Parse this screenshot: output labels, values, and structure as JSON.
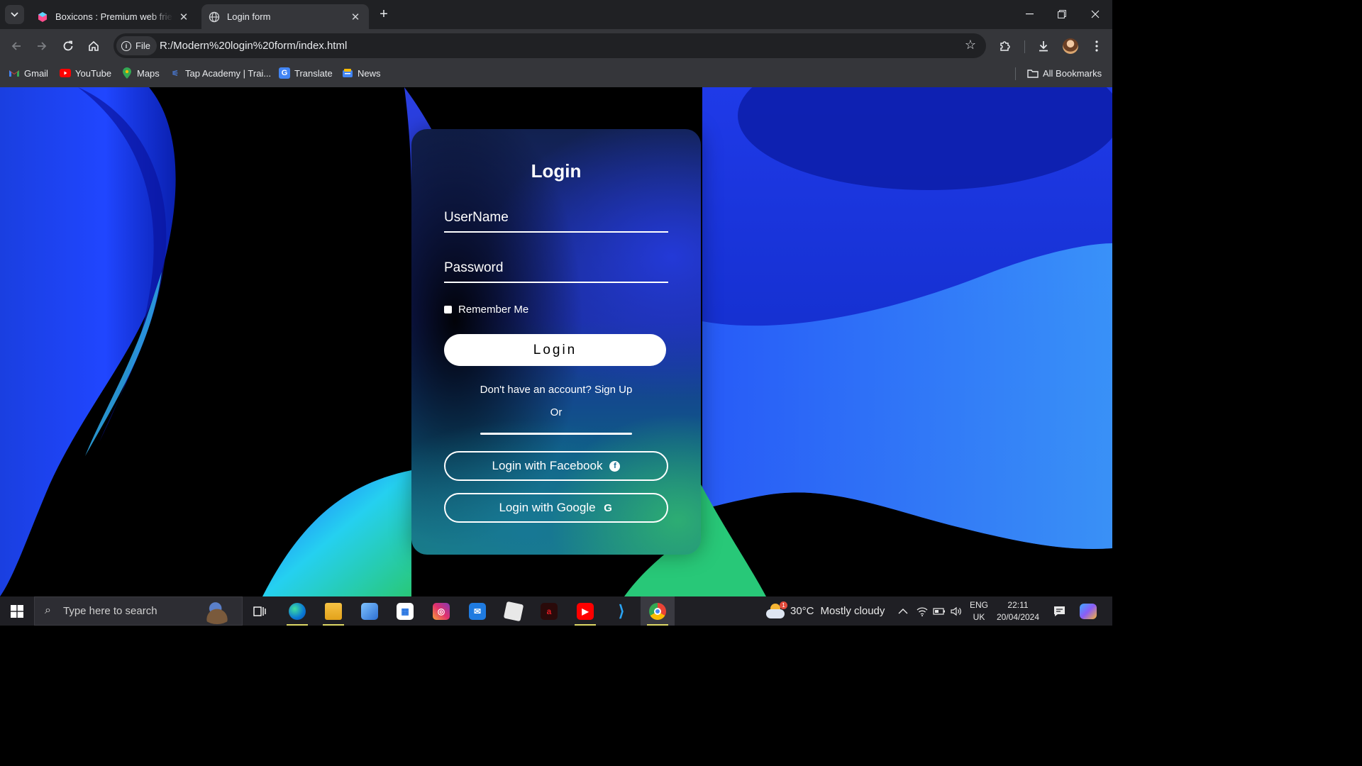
{
  "browser": {
    "tabs": [
      {
        "title": "Boxicons : Premium web friendly icons",
        "active": false,
        "favicon": "boxicons-icon"
      },
      {
        "title": "Login form",
        "active": true,
        "favicon": "globe-icon"
      }
    ],
    "close_glyph": "✕",
    "new_tab_glyph": "+",
    "omnibox": {
      "chip_label": "File",
      "url": "R:/Modern%20login%20form/index.html"
    },
    "bookmarks": [
      {
        "label": "Gmail",
        "icon": "gmail-icon",
        "color": "#ea4335"
      },
      {
        "label": "YouTube",
        "icon": "youtube-icon",
        "color": "#ff0000"
      },
      {
        "label": "Maps",
        "icon": "maps-icon",
        "color": "#34a853"
      },
      {
        "label": "Tap Academy | Trai...",
        "icon": "tap-academy-icon",
        "color": "#4a7bd8"
      },
      {
        "label": "Translate",
        "icon": "translate-icon",
        "color": "#4285f4"
      },
      {
        "label": "News",
        "icon": "news-icon",
        "color": "#4285f4"
      }
    ],
    "all_bookmarks": "All Bookmarks"
  },
  "login": {
    "title": "Login",
    "username_placeholder": "UserName",
    "password_placeholder": "Password",
    "remember_label": "Remember Me",
    "login_button": "Login",
    "no_account_text": "Don't have an account?",
    "signup_link": "Sign Up",
    "or_text": "Or",
    "facebook_button": "Login with Facebook",
    "google_button": "Login with Google",
    "colors": {
      "accent_blue": "#1f3bd6",
      "accent_green": "#2eb072",
      "card_dark": "#12214f"
    }
  },
  "taskbar": {
    "search_placeholder": "Type here to search",
    "apps": [
      "task-view-icon",
      "edge-icon",
      "file-explorer-icon",
      "laptop-icon",
      "store-icon",
      "instagram-icon",
      "mail-icon",
      "roblox-icon",
      "airtel-xstream-icon",
      "youtube-app-icon",
      "vscode-icon",
      "chrome-icon"
    ],
    "weather": {
      "temperature": "30°C",
      "condition": "Mostly cloudy",
      "badge": "1"
    },
    "language": {
      "lang": "ENG",
      "region": "UK"
    },
    "clock": {
      "time": "22:11",
      "date": "20/04/2024"
    }
  }
}
